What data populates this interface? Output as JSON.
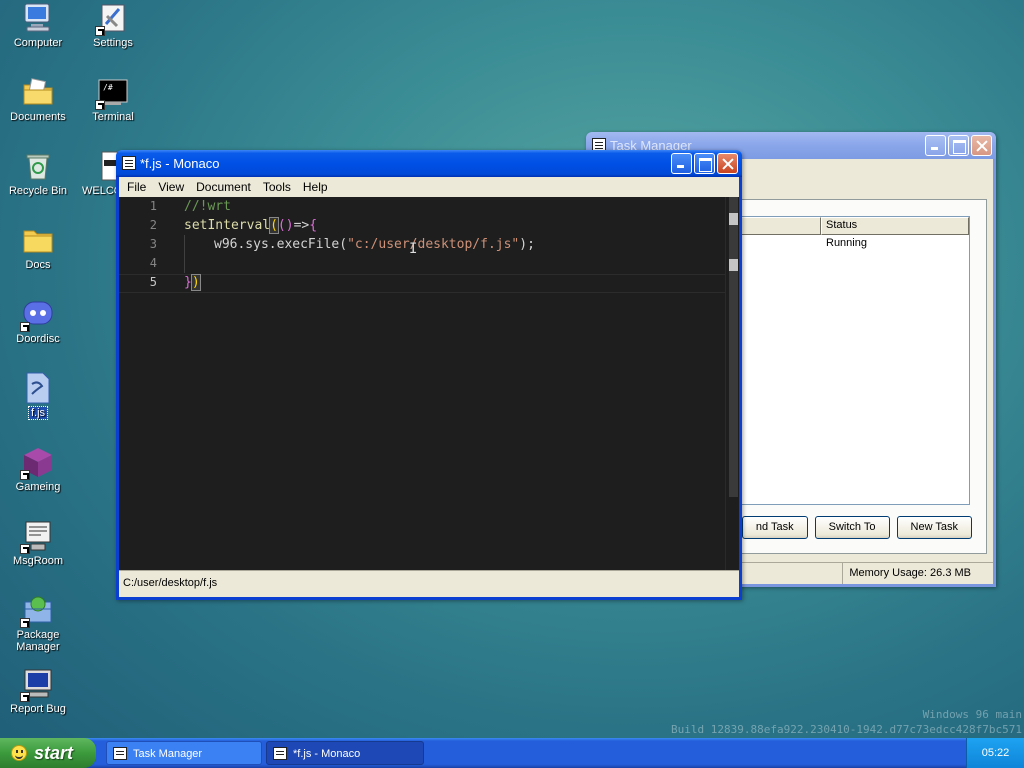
{
  "desktop": {
    "icons": [
      {
        "label": "Computer",
        "icon": "computer-icon"
      },
      {
        "label": "Settings",
        "icon": "settings-icon"
      },
      {
        "label": "Documents",
        "icon": "documents-folder-icon"
      },
      {
        "label": "Terminal",
        "icon": "terminal-icon"
      },
      {
        "label": "Recycle Bin",
        "icon": "recycle-bin-icon"
      },
      {
        "label": "WELCO",
        "icon": "welcome-doc-icon"
      },
      {
        "label": "Docs",
        "icon": "folder-icon"
      },
      {
        "label": "Doordisc",
        "icon": "doordisc-icon"
      },
      {
        "label": "f.js",
        "icon": "js-file-icon"
      },
      {
        "label": "Gameing",
        "icon": "game-cube-icon"
      },
      {
        "label": "MsgRoom",
        "icon": "msgroom-icon"
      },
      {
        "label": "Package\nManager",
        "icon": "package-manager-icon"
      },
      {
        "label": "Report Bug",
        "icon": "report-bug-icon"
      }
    ]
  },
  "task_manager": {
    "title": "Task Manager",
    "columns": [
      "",
      "Status"
    ],
    "rows": [
      {
        "name": "",
        "status": "Running"
      }
    ],
    "buttons": {
      "end_task": "nd Task",
      "switch_to": "Switch To",
      "new_task": "New Task"
    },
    "memory_usage": "Memory Usage: 26.3 MB"
  },
  "monaco": {
    "title": "*f.js - Monaco",
    "menu": [
      "File",
      "View",
      "Document",
      "Tools",
      "Help"
    ],
    "line_numbers": [
      "1",
      "2",
      "3",
      "4",
      "5"
    ],
    "code": {
      "line1": "//!wrt",
      "line2_fn": "setInterval",
      "line2_open_paren": "(",
      "line2_args": "()",
      "line2_arrow": "=>",
      "line2_brace": "{",
      "line3_call": "w96.sys.execFile(",
      "line3_str": "\"c:/user/desktop/f.js\"",
      "line3_close": ");",
      "line5_brace": "}",
      "line5_paren": ")"
    },
    "status_path": "C:/user/desktop/f.js"
  },
  "watermark": {
    "line1": "Windows 96 main",
    "line2": "Build 12839.88efa922.230410-1942.d77c73edcc428f7bc571"
  },
  "taskbar": {
    "start_label": "start",
    "items": [
      "Task Manager",
      "*f.js - Monaco"
    ],
    "clock": "05:22"
  },
  "colors": {
    "title_active": "#0050e6",
    "editor_bg": "#1e1e1e",
    "comment": "#6a9955",
    "string": "#ce9178",
    "function": "#dcdcaa",
    "taskbar": "#245edb",
    "start_green": "#3c9a3c"
  }
}
